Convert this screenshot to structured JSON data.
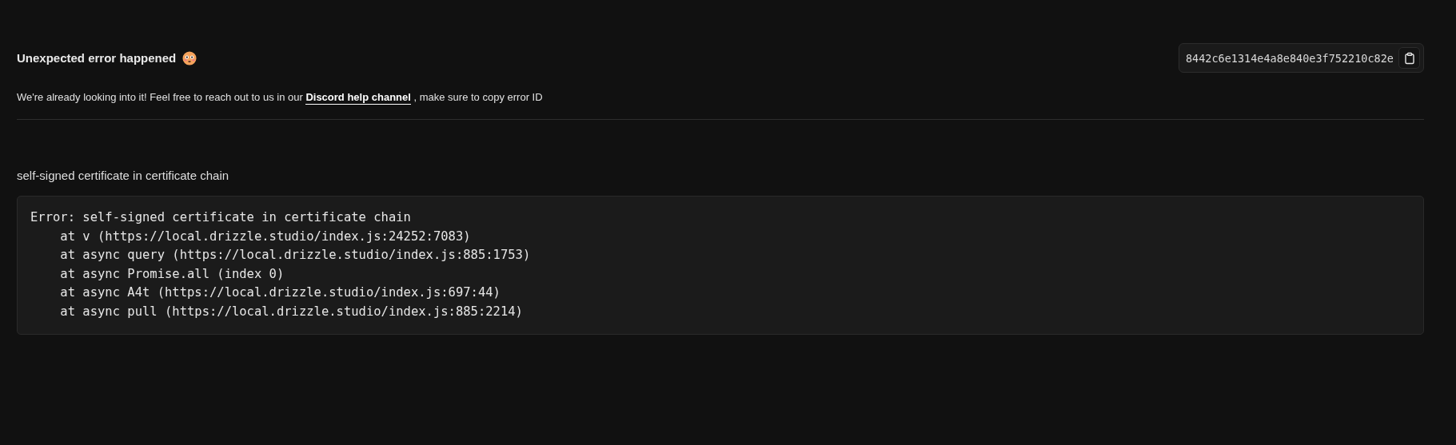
{
  "header": {
    "title": "Unexpected error happened",
    "error_id": "8442c6e1314e4a8e840e3f752210c82e"
  },
  "description": {
    "before": "We're already looking into it! Feel free to reach out to us in our",
    "link": "Discord help channel",
    "after": ", make sure to copy error ID"
  },
  "error": {
    "message": "self-signed certificate in certificate chain",
    "stack": [
      "Error: self-signed certificate in certificate chain",
      "    at v (https://local.drizzle.studio/index.js:24252:7083)",
      "    at async query (https://local.drizzle.studio/index.js:885:1753)",
      "    at async Promise.all (index 0)",
      "    at async A4t (https://local.drizzle.studio/index.js:697:44)",
      "    at async pull (https://local.drizzle.studio/index.js:885:2214)"
    ]
  }
}
